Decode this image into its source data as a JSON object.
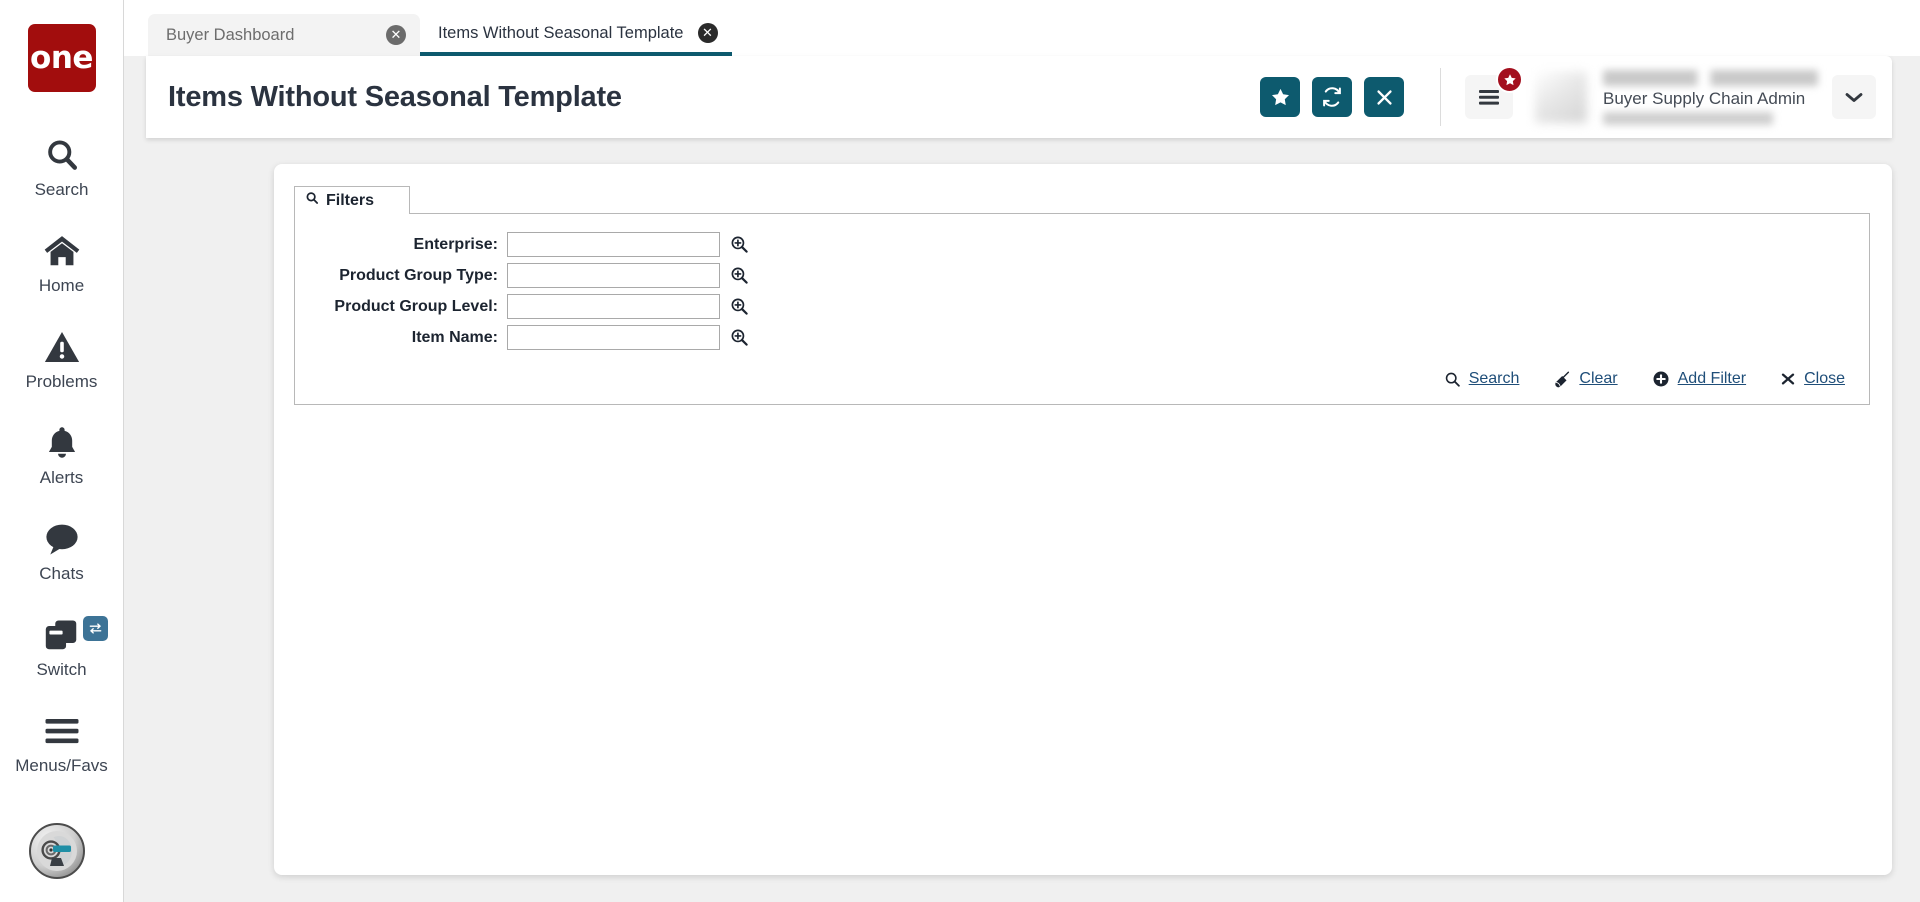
{
  "brand": {
    "logo_text": "one"
  },
  "sidebar": {
    "items": [
      {
        "label": "Search",
        "icon": "search-icon"
      },
      {
        "label": "Home",
        "icon": "home-icon"
      },
      {
        "label": "Problems",
        "icon": "warning-triangle-icon"
      },
      {
        "label": "Alerts",
        "icon": "bell-icon"
      },
      {
        "label": "Chats",
        "icon": "chat-bubble-icon"
      },
      {
        "label": "Switch",
        "icon": "switch-windows-icon"
      },
      {
        "label": "Menus/Favs",
        "icon": "hamburger-icon"
      }
    ],
    "assistant": {
      "icon": "ai-assistant-avatar-icon"
    }
  },
  "tabs": [
    {
      "label": "Buyer Dashboard",
      "active": false,
      "close_icon": "close-circle-icon"
    },
    {
      "label": "Items Without Seasonal Template",
      "active": true,
      "close_icon": "close-circle-icon"
    }
  ],
  "header": {
    "title": "Items Without Seasonal Template",
    "actions": [
      {
        "name": "favorite-button",
        "icon": "star-icon"
      },
      {
        "name": "refresh-button",
        "icon": "refresh-icon"
      },
      {
        "name": "close-button",
        "icon": "x-icon"
      }
    ],
    "menu_button": {
      "icon": "hamburger-icon",
      "badge_icon": "star-icon"
    },
    "user": {
      "name": "",
      "role": "Buyer Supply Chain Admin",
      "chevron_icon": "chevron-down-icon",
      "avatar_icon": "avatar"
    }
  },
  "filters": {
    "tab_label": "Filters",
    "tab_icon": "search-icon",
    "fields": [
      {
        "label": "Enterprise:",
        "value": "",
        "placeholder": "",
        "picker_icon": "magnifier-plus-icon"
      },
      {
        "label": "Product Group Type:",
        "value": "",
        "placeholder": "",
        "picker_icon": "magnifier-plus-icon"
      },
      {
        "label": "Product Group Level:",
        "value": "",
        "placeholder": "",
        "picker_icon": "magnifier-plus-icon"
      },
      {
        "label": "Item Name:",
        "value": "",
        "placeholder": "",
        "picker_icon": "magnifier-plus-icon"
      }
    ],
    "actions": [
      {
        "label": "Search",
        "icon": "search-icon"
      },
      {
        "label": "Clear",
        "icon": "broom-icon"
      },
      {
        "label": "Add Filter",
        "icon": "plus-circle-icon"
      },
      {
        "label": "Close",
        "icon": "x-icon"
      }
    ]
  },
  "colors": {
    "brand_red": "#a20d0d",
    "accent_teal": "#0d5a6e",
    "link_blue": "#1f4e79",
    "badge_red": "#a30f1e",
    "switch_badge_blue": "#3d7396"
  }
}
